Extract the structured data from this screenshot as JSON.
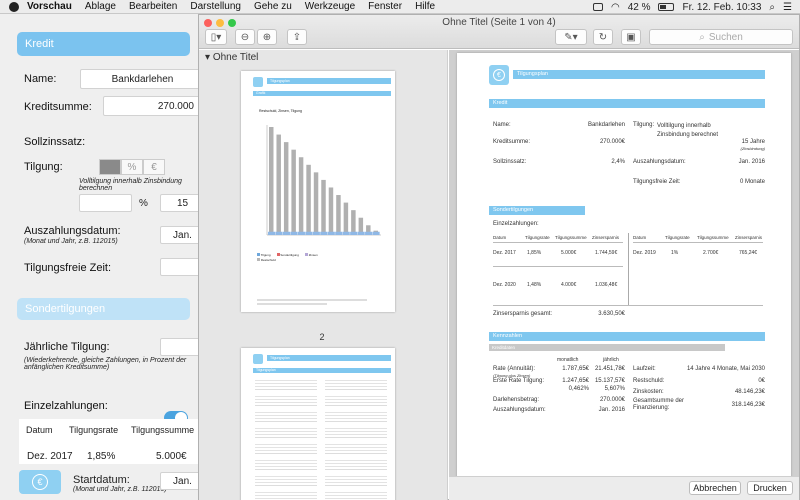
{
  "menubar": {
    "app": "Vorschau",
    "items": [
      "Ablage",
      "Bearbeiten",
      "Darstellung",
      "Gehe zu",
      "Werkzeuge",
      "Fenster",
      "Hilfe"
    ],
    "battery": "42 %",
    "clock": "Fr. 12. Feb. 10:33"
  },
  "bgapp": {
    "section_kredit": "Kredit",
    "name_label": "Name:",
    "name_value": "Bankdarlehen",
    "kreditsumme_label": "Kreditsumme:",
    "kreditsumme_value": "270.000",
    "sollzins_label": "Sollzinssatz:",
    "tilgung_label": "Tilgung:",
    "tilgung_segments": [
      "",
      "%",
      "€"
    ],
    "tilgung_note": "Volltilgung innerhalb Zinsbindung berechnen",
    "percent_sign": "%",
    "years_value": "15",
    "auszahlung_label": "Auszahlungsdatum:",
    "auszahlung_hint": "(Monat und Jahr, z.B. 112015)",
    "auszahlung_value": "Jan.",
    "tilgungsfrei_label": "Tilgungsfreie Zeit:",
    "section_sonder": "Sondertilgungen",
    "jaehrlich_label": "Jährliche Tilgung:",
    "jaehrlich_hint": "(Wiederkehrende, gleiche Zahlungen, in Prozent der anfänglichen Kreditsumme)",
    "einzel_label": "Einzelzahlungen:",
    "table_headers": [
      "Datum",
      "Tilgungsrate",
      "Tilgungssumme"
    ],
    "row": [
      "Dez. 2017",
      "1,85%",
      "5.000€"
    ],
    "startdatum_label": "Startdatum:",
    "startdatum_hint": "(Monat und Jahr, z.B. 112015)",
    "startdatum_value": "Jan."
  },
  "preview": {
    "title": "Ohne Titel (Seite 1 von 4)",
    "search_placeholder": "Suchen",
    "sidebar_header": "Ohne Titel",
    "thumb1_page_number": "2",
    "abbrechen": "Abbrechen",
    "drucken": "Drucken"
  },
  "thumb1": {
    "header": "Tilgungsplan",
    "subheader": "Grafik",
    "chart_title": "Restschuld, Zinsen, Tilgung",
    "legend": [
      "Tilgung",
      "Sondertilgung",
      "Zinsen",
      "Restschuld"
    ]
  },
  "chart_data": {
    "type": "bar",
    "title": "Restschuld, Zinsen, Tilgung",
    "series": [
      {
        "name": "Restschuld",
        "values": [
          100,
          93,
          86,
          79,
          72,
          65,
          58,
          51,
          44,
          37,
          30,
          23,
          16,
          9,
          4
        ]
      },
      {
        "name": "Tilgung",
        "values": [
          3,
          3,
          3,
          3,
          3,
          3,
          3,
          3,
          3,
          3,
          3,
          3,
          3,
          3,
          3
        ]
      }
    ],
    "ylim": [
      0,
      100
    ],
    "legend_placement": "bottom-left"
  },
  "thumb2": {
    "header": "Tilgungsplan",
    "subheader": "Tilgungsplan"
  },
  "page1": {
    "header": "Tilgungsplan",
    "kredit_bar": "Kredit",
    "name_label": "Name:",
    "name_value": "Bankdarlehen",
    "summe_label": "Kreditsumme:",
    "summe_value": "270.000€",
    "zins_label": "Sollzinssatz:",
    "zins_value": "2,4%",
    "tilgung_label": "Tilgung:",
    "tilgung_value": "Volltilgung innerhalb Zinsbindung berechnet",
    "jahre_value": "15 Jahre",
    "jahre_hint": "(Zinsbindung)",
    "ausz_label": "Auszahlungsdatum:",
    "ausz_value": "Jan. 2016",
    "tfz_label": "Tilgungsfreie Zeit:",
    "tfz_value": "0  Monate",
    "sonder_bar": "Sondertilgungen",
    "einzel_label": "Einzelzahlungen:",
    "cols": [
      "Datum",
      "Tilgungsrate",
      "Tilgungssumme",
      "Zinsersparnis"
    ],
    "r1": [
      "Dez. 2017",
      "1,85%",
      "5.000€",
      "1.744,59€"
    ],
    "r2": [
      "Dez. 2019",
      "1%",
      "2.700€",
      "765,24€"
    ],
    "r3": [
      "Dez. 2020",
      "1,48%",
      "4.000€",
      "1.036,48€"
    ],
    "ersparnis_label": "Zinsersparnis gesamt:",
    "ersparnis_value": "3.630,50€",
    "kenn_bar": "Kennzahlen",
    "kenn_sub": "Kreditdaten",
    "monatlich": "monatlich",
    "jaehrlich": "jährlich",
    "rate_label": "Rate (Annuität):",
    "rate_hint": "(Tilgung plus Zinsen)",
    "rate_m": "1.787,65€",
    "rate_j": "21.451,78€",
    "erste_label": "Erste Rate Tilgung:",
    "erste_m": "1.247,65€",
    "erste_j": "15.137,57€",
    "erste_m2": "0,462%",
    "erste_j2": "5,607%",
    "laufzeit_label": "Laufzeit:",
    "laufzeit_value": "14 Jahre 4 Monate, Mai 2030",
    "restschuld_label": "Restschuld:",
    "restschuld_value": "0€",
    "zinsk_label": "Zinskosten:",
    "zinsk_value": "48.146,23€",
    "gesamt_label": "Gesamtsumme der Finanzierung:",
    "gesamt_value": "318.146,23€",
    "darlehen_label": "Darlehensbetrag:",
    "darlehen_value": "270.000€",
    "ausz2_label": "Auszahlungsdatum:",
    "ausz2_value": "Jan. 2016"
  },
  "colors": {
    "accent": "#7fc7ef",
    "toggle": "#4aa3df",
    "traffic_red": "#fc605c",
    "traffic_yellow": "#fdbc40",
    "traffic_green": "#34c84a"
  }
}
